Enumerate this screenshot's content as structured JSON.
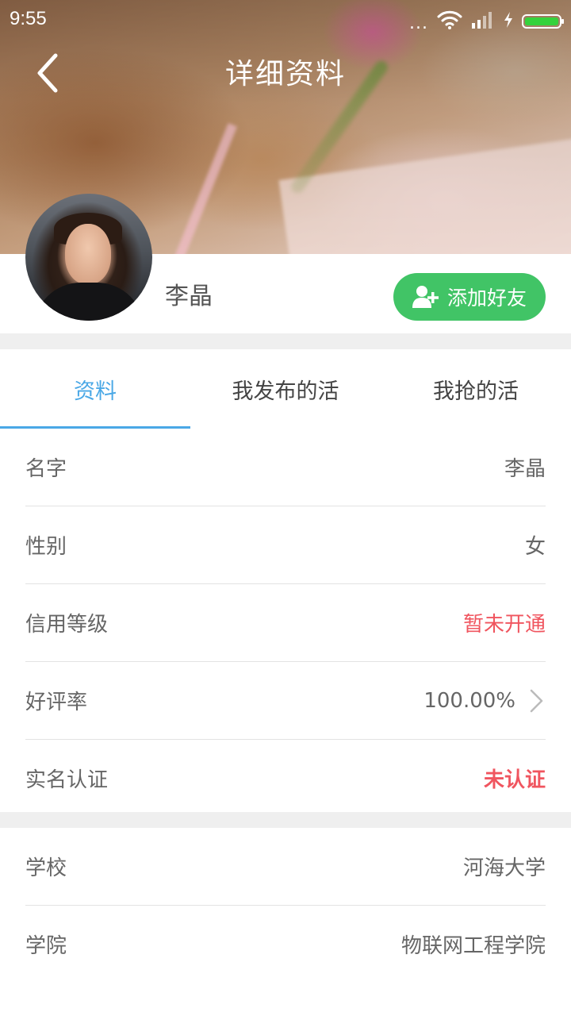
{
  "status_bar": {
    "time": "9:55",
    "more_dots": "...",
    "icons": [
      "wifi-icon",
      "signal-icon",
      "charging-icon",
      "battery-icon"
    ],
    "battery_color": "#35d23c"
  },
  "header": {
    "title": "详细资料",
    "back_icon": "chevron-left-icon"
  },
  "profile": {
    "name": "李晶",
    "add_friend_label": "添加好友",
    "add_friend_icon": "add-user-icon",
    "button_color": "#41c466"
  },
  "tabs": [
    {
      "label": "资料",
      "active": true
    },
    {
      "label": "我发布的活",
      "active": false
    },
    {
      "label": "我抢的活",
      "active": false
    }
  ],
  "accent_color": "#4aa8e6",
  "warning_color": "#f0555f",
  "info_section_1": [
    {
      "label": "名字",
      "value": "李晶"
    },
    {
      "label": "性别",
      "value": "女"
    },
    {
      "label": "信用等级",
      "value": "暂未开通"
    },
    {
      "label": "好评率",
      "value": "100.00%"
    },
    {
      "label": "实名认证",
      "value": "未认证"
    }
  ],
  "info_section_2": [
    {
      "label": "学校",
      "value": "河海大学"
    },
    {
      "label": "学院",
      "value": "物联网工程学院"
    }
  ]
}
